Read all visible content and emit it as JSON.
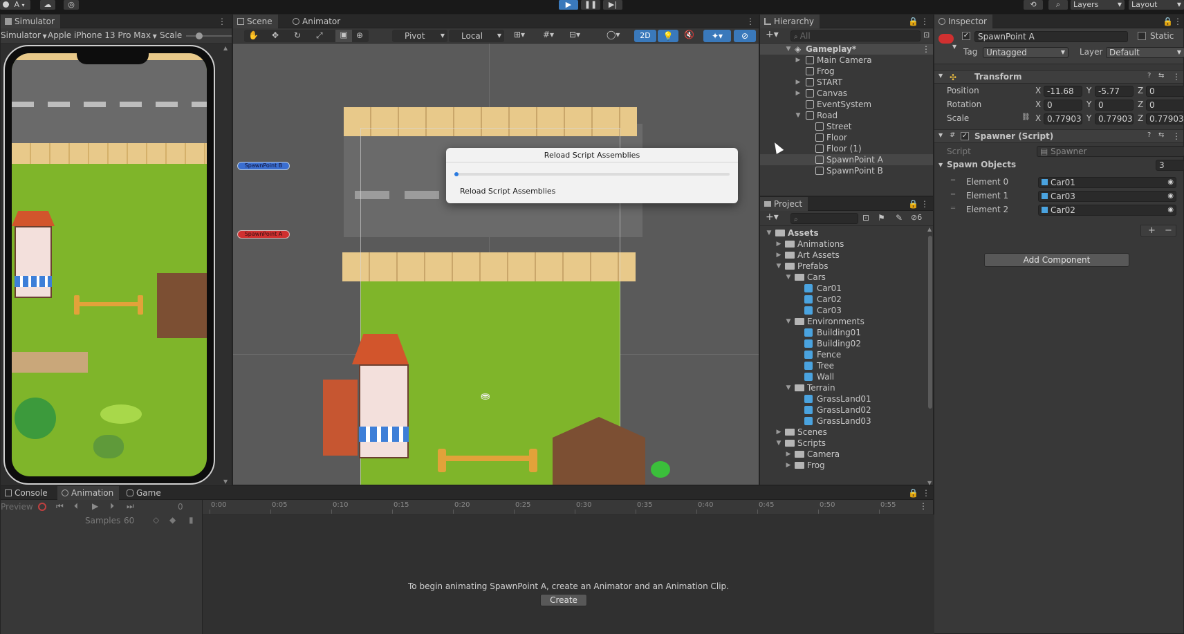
{
  "colors": {
    "accent_blue": "#3a79bb",
    "road": "#6a6a6a",
    "grass": "#7fb52a",
    "wall": "#e8c98a",
    "spawn_a": "#d03030",
    "spawn_b": "#3a6ed0",
    "prefab_blue": "#4aa3df"
  },
  "toolbar": {
    "account_label": "A",
    "layers_label": "Layers",
    "layout_label": "Layout"
  },
  "simulator": {
    "tab_label": "Simulator",
    "mode_label": "Simulator",
    "device_label": "Apple iPhone 13 Pro Max",
    "scale_label": "Scale"
  },
  "scene": {
    "tab_scene": "Scene",
    "tab_animator": "Animator",
    "pivot_label": "Pivot",
    "local_label": "Local",
    "mode_2d": "2D",
    "spawn_b_label": "SpawnPoint B",
    "spawn_a_label": "SpawnPoint A"
  },
  "dialog": {
    "title": "Reload Script Assemblies",
    "progress": 0.01,
    "status": "Reload Script Assemblies"
  },
  "hierarchy": {
    "tab_label": "Hierarchy",
    "search_placeholder": "All",
    "root_label": "Gameplay*",
    "items": [
      {
        "label": "Main Camera"
      },
      {
        "label": "Frog"
      },
      {
        "label": "START"
      },
      {
        "label": "Canvas"
      },
      {
        "label": "EventSystem"
      },
      {
        "label": "Road"
      },
      {
        "label": "Street"
      },
      {
        "label": "Floor"
      },
      {
        "label": "Floor (1)"
      },
      {
        "label": "SpawnPoint A"
      },
      {
        "label": "SpawnPoint B"
      }
    ]
  },
  "project": {
    "tab_label": "Project",
    "hidden_count": "6",
    "items": [
      {
        "label": "Assets"
      },
      {
        "label": "Animations"
      },
      {
        "label": "Art Assets"
      },
      {
        "label": "Prefabs"
      },
      {
        "label": "Cars"
      },
      {
        "label": "Car01"
      },
      {
        "label": "Car02"
      },
      {
        "label": "Car03"
      },
      {
        "label": "Environments"
      },
      {
        "label": "Building01"
      },
      {
        "label": "Building02"
      },
      {
        "label": "Fence"
      },
      {
        "label": "Tree"
      },
      {
        "label": "Wall"
      },
      {
        "label": "Terrain"
      },
      {
        "label": "GrassLand01"
      },
      {
        "label": "GrassLand02"
      },
      {
        "label": "GrassLand03"
      },
      {
        "label": "Scenes"
      },
      {
        "label": "Scripts"
      },
      {
        "label": "Camera"
      },
      {
        "label": "Frog"
      }
    ]
  },
  "inspector": {
    "tab_label": "Inspector",
    "object_name": "SpawnPoint A",
    "static_label": "Static",
    "tag_label": "Tag",
    "tag_value": "Untagged",
    "layer_label": "Layer",
    "layer_value": "Default",
    "transform_label": "Transform",
    "position_label": "Position",
    "rotation_label": "Rotation",
    "scale_label": "Scale",
    "x": "X",
    "y": "Y",
    "z": "Z",
    "position": {
      "x": "-11.68",
      "y": "-5.77",
      "z": "0"
    },
    "rotation": {
      "x": "0",
      "y": "0",
      "z": "0"
    },
    "scale": {
      "x": "0.77903",
      "y": "0.77903",
      "z": "0.77903"
    },
    "script_component_label": "Spawner (Script)",
    "script_label": "Script",
    "script_value": "Spawner",
    "spawn_objects_label": "Spawn Objects",
    "spawn_objects_count": "3",
    "elements": [
      {
        "label": "Element 0",
        "value": "Car01"
      },
      {
        "label": "Element 1",
        "value": "Car03"
      },
      {
        "label": "Element 2",
        "value": "Car02"
      }
    ],
    "plus": "+",
    "minus": "−",
    "add_component_label": "Add Component"
  },
  "bottom": {
    "tab_console": "Console",
    "tab_animation": "Animation",
    "tab_game": "Game",
    "preview_label": "Preview",
    "frame_value": "0",
    "samples_label": "Samples",
    "samples_value": "60",
    "ticks": [
      "0:00",
      "0:05",
      "0:10",
      "0:15",
      "0:20",
      "0:25",
      "0:30",
      "0:35",
      "0:40",
      "0:45",
      "0:50",
      "0:55"
    ],
    "hint_text": "To begin animating SpawnPoint A, create an Animator and an Animation Clip.",
    "create_label": "Create"
  }
}
